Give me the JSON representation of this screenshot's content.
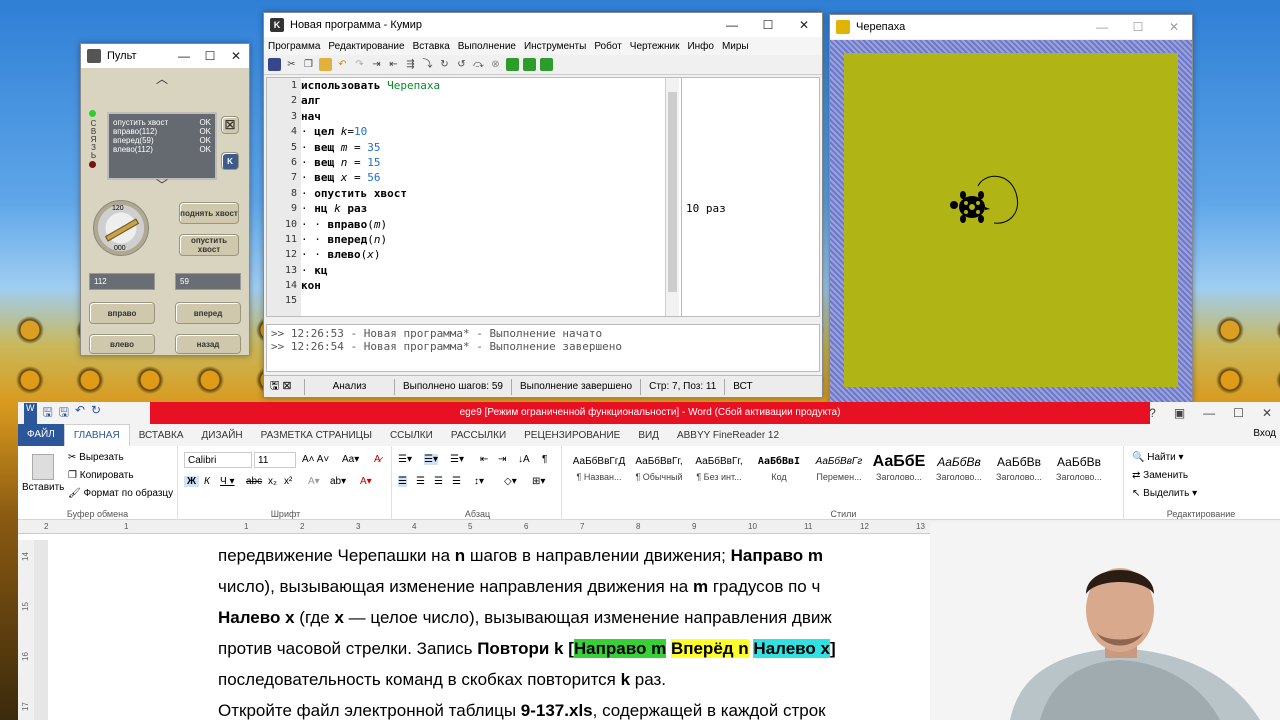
{
  "pult": {
    "title": "Пульт",
    "connection_label": "СВЯЗЬ",
    "log": [
      {
        "cmd": "опустить хвост",
        "status": "OK"
      },
      {
        "cmd": "вправо(112)",
        "status": "OK"
      },
      {
        "cmd": "вперед(59)",
        "status": "OK"
      },
      {
        "cmd": "влево(112)",
        "status": "OK"
      }
    ],
    "dial": {
      "top": "120",
      "bottom": "000"
    },
    "buttons": {
      "raise_tail": "поднять хвост",
      "lower_tail": "опустить хвост",
      "right": "вправо",
      "forward": "вперед",
      "left": "влево",
      "back": "назад"
    },
    "fields": {
      "angle": "112",
      "distance": "59"
    },
    "k_label": "K"
  },
  "kumir": {
    "title": "Новая программа - Кумир",
    "menu": [
      "Программа",
      "Редактирование",
      "Вставка",
      "Выполнение",
      "Инструменты",
      "Робот",
      "Чертежник",
      "Инфо",
      "Миры"
    ],
    "lines": [
      {
        "n": "1",
        "segs": [
          {
            "t": "использовать ",
            "c": "kw"
          },
          {
            "t": "Черепаха",
            "c": "grn"
          }
        ]
      },
      {
        "n": "2",
        "segs": [
          {
            "t": "алг",
            "c": "kw"
          }
        ]
      },
      {
        "n": "3",
        "segs": [
          {
            "t": "нач",
            "c": "kw"
          }
        ]
      },
      {
        "n": "4",
        "segs": [
          {
            "t": "· ",
            "c": ""
          },
          {
            "t": "цел ",
            "c": "kw"
          },
          {
            "t": "k",
            "c": "var"
          },
          {
            "t": "=",
            "c": ""
          },
          {
            "t": "10",
            "c": "num"
          }
        ]
      },
      {
        "n": "5",
        "segs": [
          {
            "t": "· ",
            "c": ""
          },
          {
            "t": "вещ ",
            "c": "kw"
          },
          {
            "t": "m",
            "c": "var"
          },
          {
            "t": " = ",
            "c": ""
          },
          {
            "t": "35",
            "c": "num"
          }
        ]
      },
      {
        "n": "6",
        "segs": [
          {
            "t": "· ",
            "c": ""
          },
          {
            "t": "вещ ",
            "c": "kw"
          },
          {
            "t": "n",
            "c": "var"
          },
          {
            "t": " = ",
            "c": ""
          },
          {
            "t": "15",
            "c": "num"
          }
        ]
      },
      {
        "n": "7",
        "segs": [
          {
            "t": "· ",
            "c": ""
          },
          {
            "t": "вещ ",
            "c": "kw"
          },
          {
            "t": "x",
            "c": "var"
          },
          {
            "t": " = ",
            "c": ""
          },
          {
            "t": "56",
            "c": "num"
          }
        ]
      },
      {
        "n": "8",
        "segs": [
          {
            "t": "· ",
            "c": ""
          },
          {
            "t": "опустить хвост",
            "c": "kw"
          }
        ]
      },
      {
        "n": "9",
        "segs": [
          {
            "t": "· ",
            "c": ""
          },
          {
            "t": "нц ",
            "c": "kw"
          },
          {
            "t": "k",
            "c": "var"
          },
          {
            "t": " раз",
            "c": "kw"
          }
        ]
      },
      {
        "n": "10",
        "segs": [
          {
            "t": "· · ",
            "c": ""
          },
          {
            "t": "вправо",
            "c": "kw"
          },
          {
            "t": "(",
            "c": ""
          },
          {
            "t": "m",
            "c": "var"
          },
          {
            "t": ")",
            "c": ""
          }
        ]
      },
      {
        "n": "11",
        "segs": [
          {
            "t": "· · ",
            "c": ""
          },
          {
            "t": "вперед",
            "c": "kw"
          },
          {
            "t": "(",
            "c": ""
          },
          {
            "t": "n",
            "c": "var"
          },
          {
            "t": ")",
            "c": ""
          }
        ]
      },
      {
        "n": "12",
        "segs": [
          {
            "t": "· · ",
            "c": ""
          },
          {
            "t": "влево",
            "c": "kw"
          },
          {
            "t": "(",
            "c": ""
          },
          {
            "t": "x",
            "c": "var"
          },
          {
            "t": ")",
            "c": ""
          }
        ]
      },
      {
        "n": "13",
        "segs": [
          {
            "t": "· ",
            "c": ""
          },
          {
            "t": "кц",
            "c": "kw"
          }
        ]
      },
      {
        "n": "14",
        "segs": [
          {
            "t": "кон",
            "c": "kw"
          }
        ]
      },
      {
        "n": "15",
        "segs": []
      }
    ],
    "output_margin": "10 раз",
    "messages": [
      ">> 12:26:53 - Новая программа* - Выполнение начато",
      ">> 12:26:54 - Новая программа* - Выполнение завершено"
    ],
    "status": {
      "mode": "Анализ",
      "steps": "Выполнено шагов: 59",
      "state": "Выполнение завершено",
      "pos": "Стр: 7, Поз: 11",
      "ins": "ВСТ"
    }
  },
  "turtle": {
    "title": "Черепаха",
    "field_color": "#b0b414"
  },
  "word": {
    "title": "ege9 [Режим ограниченной функциональности] - Word (Сбой активации продукта)",
    "signin": "Вход",
    "tabs": [
      "ФАЙЛ",
      "ГЛАВНАЯ",
      "ВСТАВКА",
      "ДИЗАЙН",
      "РАЗМЕТКА СТРАНИЦЫ",
      "ССЫЛКИ",
      "РАССЫЛКИ",
      "РЕЦЕНЗИРОВАНИЕ",
      "ВИД",
      "ABBYY FineReader 12"
    ],
    "clipboard": {
      "paste": "Вставить",
      "cut": "Вырезать",
      "copy": "Копировать",
      "format": "Формат по образцу",
      "label": "Буфер обмена"
    },
    "font": {
      "name": "Calibri",
      "size": "11",
      "label": "Шрифт"
    },
    "paragraph_label": "Абзац",
    "styles": [
      {
        "sample": "АаБбВвГгД",
        "name": "¶ Назван..."
      },
      {
        "sample": "АаБбВвГг,",
        "name": "¶ Обычный"
      },
      {
        "sample": "АаБбВвГг,",
        "name": "¶ Без инт..."
      },
      {
        "sample": "АаБбВвI",
        "name": "Код"
      },
      {
        "sample": "АаБбВвГг",
        "name": "Перемен..."
      },
      {
        "sample": "АаБбЕ",
        "name": "Заголово..."
      },
      {
        "sample": "АаБбВв",
        "name": "Заголово..."
      },
      {
        "sample": "АаБбВв",
        "name": "Заголово..."
      },
      {
        "sample": "АаБбВв",
        "name": "Заголово..."
      }
    ],
    "styles_label": "Стили",
    "editing": {
      "find": "Найти",
      "replace": "Заменить",
      "select": "Выделить",
      "label": "Редактирование"
    },
    "ruler_marks": [
      "2",
      "1",
      "1",
      "2",
      "3",
      "4",
      "5",
      "6",
      "7",
      "8",
      "9",
      "10",
      "11",
      "12",
      "13"
    ],
    "vruler_marks": [
      "14",
      "15",
      "16",
      "17"
    ],
    "doc_lines": [
      [
        {
          "t": "передвижение Черепашки на "
        },
        {
          "t": "n",
          "b": true
        },
        {
          "t": " шагов в направлении движения; "
        },
        {
          "t": "Направо m",
          "b": true
        }
      ],
      [
        {
          "t": "число), вызывающая изменение направления движения на "
        },
        {
          "t": "m",
          "b": true
        },
        {
          "t": " градусов по ч"
        }
      ],
      [
        {
          "t": "Налево x",
          "b": true
        },
        {
          "t": " (где "
        },
        {
          "t": "x",
          "b": true
        },
        {
          "t": " — целое число), вызывающая изменение направления движ"
        }
      ],
      [
        {
          "t": "против часовой стрелки. Запись "
        },
        {
          "t": "Повтори k",
          "b": true
        },
        {
          "t": " [",
          "b": true
        },
        {
          "t": "Направо m",
          "b": true,
          "h": "g"
        },
        {
          "t": " ",
          "b": true
        },
        {
          "t": "Вперёд n",
          "b": true,
          "h": "y"
        },
        {
          "t": " ",
          "b": true
        },
        {
          "t": "Налево x",
          "b": true,
          "h": "c"
        },
        {
          "t": "]",
          "b": true
        }
      ],
      [
        {
          "t": "последовательность команд в скобках повторится "
        },
        {
          "t": "k",
          "b": true
        },
        {
          "t": " раз."
        }
      ],
      [
        {
          "t": "Откройте файл электронной таблицы "
        },
        {
          "t": "9-137.xls",
          "b": true
        },
        {
          "t": ", содержащей в каждой строк"
        }
      ]
    ]
  }
}
